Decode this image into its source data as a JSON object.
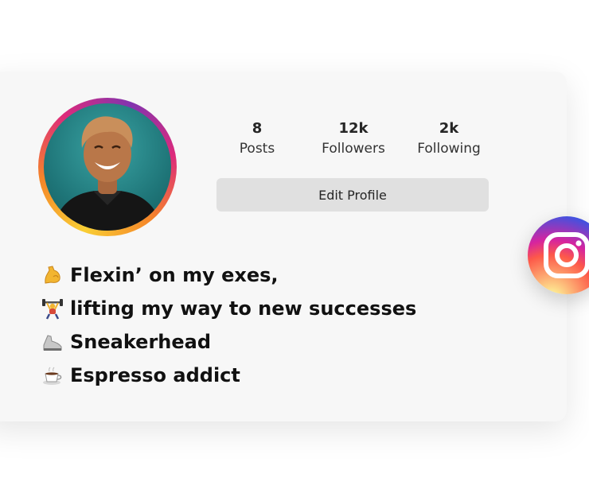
{
  "profile": {
    "stats": [
      {
        "value": "8",
        "label": "Posts"
      },
      {
        "value": "12k",
        "label": "Followers"
      },
      {
        "value": "2k",
        "label": "Following"
      }
    ],
    "edit_button_label": "Edit Profile",
    "bio": [
      {
        "icon": "flexed-biceps-icon",
        "text": "Flexin’ on my exes,"
      },
      {
        "icon": "weightlifter-icon",
        "text": "lifting my way to new successes"
      },
      {
        "icon": "sneaker-icon",
        "text": "Sneakerhead"
      },
      {
        "icon": "coffee-cup-icon",
        "text": "Espresso addict"
      }
    ]
  },
  "colors": {
    "ring_gradient": [
      "#f9ce34",
      "#ee2a7b",
      "#6228d7"
    ],
    "button_bg": "#e0e0e0",
    "text": "#262626"
  }
}
